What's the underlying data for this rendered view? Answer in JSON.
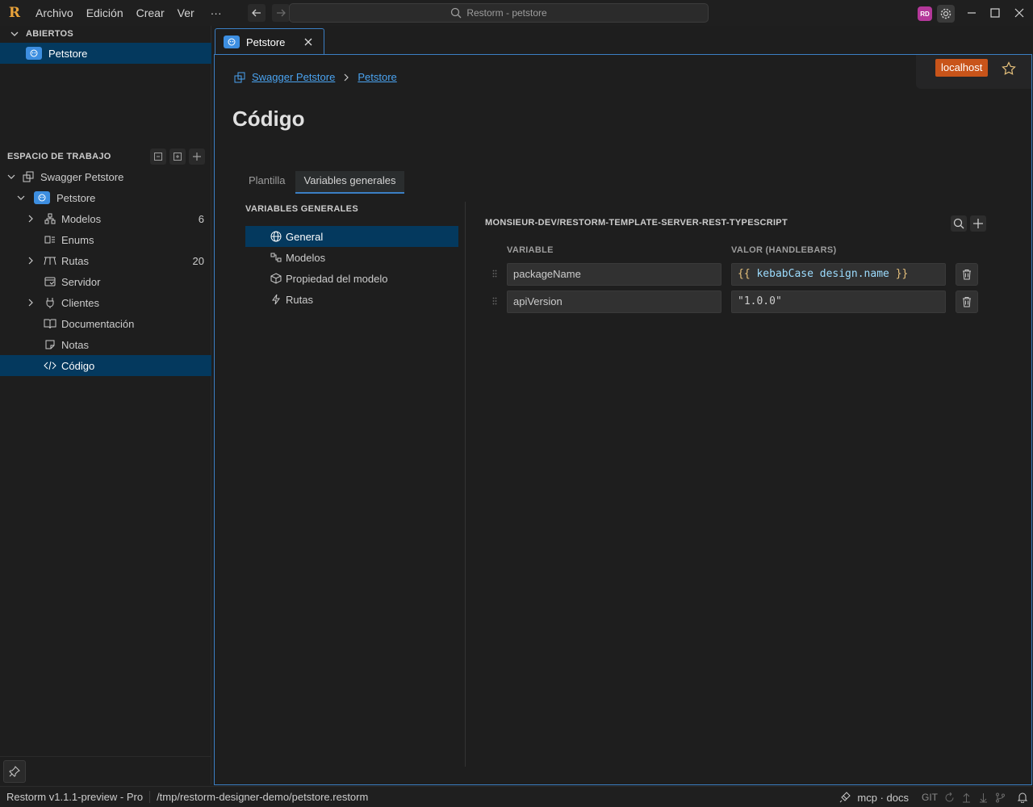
{
  "app": {
    "logo_letter": "R",
    "menu": [
      "Archivo",
      "Edición",
      "Crear",
      "Ver"
    ],
    "more_label": "···",
    "search_text": "Restorm - petstore",
    "avatar_initials": "RD",
    "accent_color": "#3b7fc4",
    "selection_color": "#04395e"
  },
  "sidebar": {
    "open_header": "ABIERTOS",
    "open_item": "Petstore",
    "workspace_header": "ESPACIO DE TRABAJO",
    "tree": [
      {
        "label": "Swagger Petstore",
        "icon": "workspace-icon",
        "count": ""
      },
      {
        "label": "Petstore",
        "icon": "petstore-icon",
        "count": ""
      },
      {
        "label": "Modelos",
        "icon": "models-icon",
        "count": "6"
      },
      {
        "label": "Enums",
        "icon": "enums-icon",
        "count": ""
      },
      {
        "label": "Rutas",
        "icon": "routes-icon",
        "count": "20"
      },
      {
        "label": "Servidor",
        "icon": "server-icon",
        "count": ""
      },
      {
        "label": "Clientes",
        "icon": "clients-icon",
        "count": ""
      },
      {
        "label": "Documentación",
        "icon": "documentation-icon",
        "count": ""
      },
      {
        "label": "Notas",
        "icon": "notes-icon",
        "count": ""
      },
      {
        "label": "Código",
        "icon": "code-icon",
        "count": ""
      }
    ]
  },
  "tabs": {
    "active_label": "Petstore"
  },
  "env": {
    "badge": "localhost",
    "badge_color": "#c8541a"
  },
  "breadcrumb": [
    "Swagger Petstore",
    "Petstore"
  ],
  "page": {
    "title": "Código",
    "inner_tabs": [
      "Plantilla",
      "Variables generales"
    ],
    "active_inner_tab": "Variables generales",
    "left_title": "VARIABLES GENERALES",
    "left_items": [
      {
        "label": "General",
        "icon": "globe-icon"
      },
      {
        "label": "Modelos",
        "icon": "models-icon"
      },
      {
        "label": "Propiedad del modelo",
        "icon": "cube-icon"
      },
      {
        "label": "Rutas",
        "icon": "lightning-icon"
      }
    ],
    "repo_title": "MONSIEUR-DEV/RESTORM-TEMPLATE-SERVER-REST-TYPESCRIPT",
    "col_variable": "VARIABLE",
    "col_value": "VALOR (HANDLEBARS)",
    "variables": [
      {
        "name": "packageName",
        "open": "{{",
        "expr": "kebabCase design.name",
        "close": "}}"
      },
      {
        "name": "apiVersion",
        "value": "\"1.0.0\""
      }
    ]
  },
  "status": {
    "version": "Restorm v1.1.1-preview - Pro",
    "path": "/tmp/restorm-designer-demo/petstore.restorm",
    "mcp": "mcp · docs",
    "git": "GIT"
  }
}
